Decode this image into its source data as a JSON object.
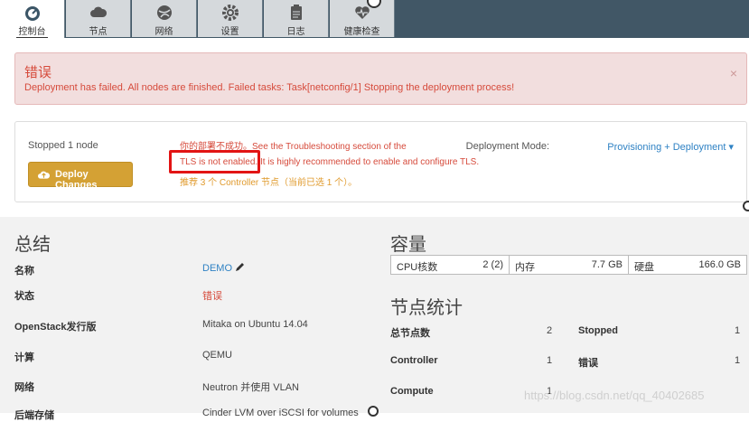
{
  "tabs": [
    {
      "label": "控制台",
      "icon": "dashboard-icon",
      "active": true
    },
    {
      "label": "节点",
      "icon": "cloud-icon"
    },
    {
      "label": "网络",
      "icon": "globe-icon"
    },
    {
      "label": "设置",
      "icon": "gear-icon"
    },
    {
      "label": "日志",
      "icon": "clipboard-icon"
    },
    {
      "label": "健康检查",
      "icon": "heart-icon"
    }
  ],
  "alert": {
    "title": "错误",
    "message": "Deployment has failed. All nodes are finished. Failed tasks: Task[netconfig/1] Stopping the deployment process!",
    "close": "×"
  },
  "deploy": {
    "status": "Stopped 1 node",
    "button_label": "Deploy Changes",
    "warning_line1": "你的部署不成功。See the Troubleshooting section of the",
    "warning_line2": "TLS is not enabled. It is highly recommended to enable and configure TLS.",
    "warning_line3": "推荐 3 个 Controller 节点（当前已选 1 个）。",
    "mode_label": "Deployment Mode:",
    "mode_value": "Provisioning + Deployment ▾"
  },
  "summary": {
    "title": "总结",
    "rows": [
      {
        "key": "名称",
        "value": "DEMO"
      },
      {
        "key": "状态",
        "value": "错误"
      },
      {
        "key": "OpenStack发行版",
        "value": "Mitaka on Ubuntu 14.04"
      },
      {
        "key": "计算",
        "value": "QEMU"
      },
      {
        "key": "网络",
        "value": "Neutron 并使用 VLAN"
      },
      {
        "key": "后端存储",
        "value": "Cinder LVM over iSCSI for volumes"
      }
    ]
  },
  "capacity": {
    "title": "容量",
    "cells": [
      {
        "label": "CPU核数",
        "value": "2 (2)"
      },
      {
        "label": "内存",
        "value": "7.7 GB"
      },
      {
        "label": "硬盘",
        "value": "166.0 GB"
      }
    ]
  },
  "node_stats": {
    "title": "节点统计",
    "left": [
      {
        "label": "总节点数",
        "value": "2"
      },
      {
        "label": "Controller",
        "value": "1"
      },
      {
        "label": "Compute",
        "value": "1"
      }
    ],
    "right": [
      {
        "label": "Stopped",
        "value": "1"
      },
      {
        "label": "错误",
        "value": "1"
      }
    ]
  },
  "watermark": "https://blog.csdn.net/qq_40402685",
  "colors": {
    "error": "#d64a3b",
    "accent": "#2f82c4",
    "button": "#d4a134",
    "topbar": "#415766"
  }
}
